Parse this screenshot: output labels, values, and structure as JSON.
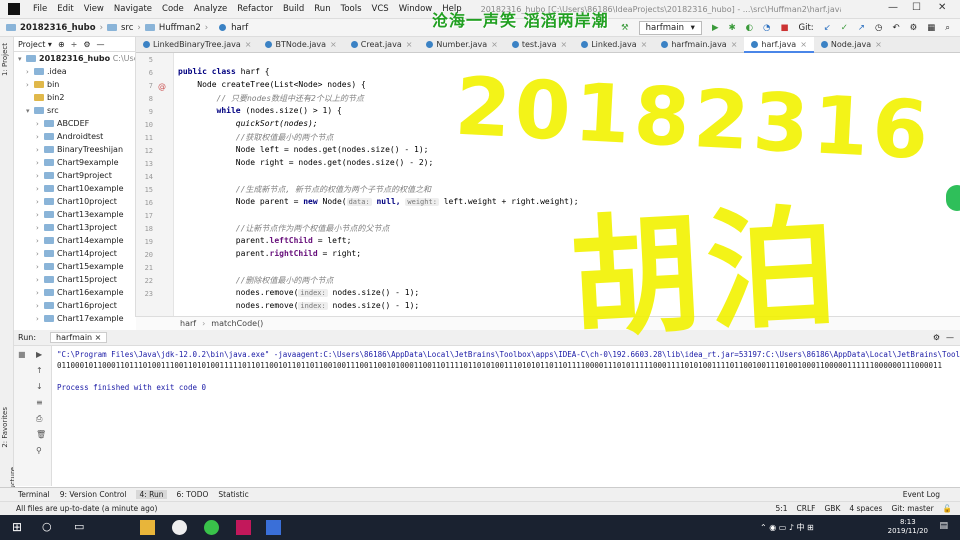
{
  "menubar": {
    "items": [
      "File",
      "Edit",
      "View",
      "Navigate",
      "Code",
      "Analyze",
      "Refactor",
      "Build",
      "Run",
      "Tools",
      "VCS",
      "Window",
      "Help"
    ],
    "window_title": "20182316_hubo [C:\\Users\\86186\\IdeaProjects\\20182316_hubo] - ...\\src\\Huffman2\\harf.java - IntelliJ IDEA"
  },
  "overlay": {
    "banner": "沧海一声笑 滔滔两岸潮",
    "handwriting_id": "20182316",
    "handwriting_name": "胡泊"
  },
  "navbar": {
    "project": "20182316_hubo",
    "src": "src",
    "pkg": "Huffman2",
    "file": "harf",
    "run_config": "harfmain",
    "git_label": "Git:"
  },
  "project": {
    "header": "Project",
    "root_label": "20182316_hubo",
    "root_path": "C:\\Users\\86186\\",
    "items": [
      ".idea",
      "bin",
      "bin2",
      "src",
      "ABCDEF",
      "Androidtest",
      "BinaryTreeshijan",
      "Chart9example",
      "Chart9project",
      "Chart10example",
      "Chart10project",
      "Chart13example",
      "Chart13project",
      "Chart14example",
      "Chart14project",
      "Chart15example",
      "Chart15project",
      "Chart16example",
      "Chart16project",
      "Chart17example"
    ]
  },
  "tabs": [
    "LinkedBinaryTree.java",
    "BTNode.java",
    "Creat.java",
    "Number.java",
    "test.java",
    "Linked.java",
    "harfmain.java",
    "harf.java",
    "Node.java"
  ],
  "editor": {
    "line_numbers": [
      "5",
      "6",
      "7",
      "8",
      "9",
      "10",
      "11",
      "12",
      "13",
      "14",
      "15",
      "16",
      "17",
      "18",
      "19",
      "20",
      "21",
      "22",
      "23"
    ],
    "l6_kw": "public class",
    "l6_rest": "harf {",
    "l7": "    Node createTree(List<Node> nodes) {",
    "l8": "        // 只要nodes数组中还有2个以上的节点",
    "l9_kw": "while",
    "l9_rest": " (nodes.size() > 1) {",
    "l10": "            quickSort(nodes);",
    "l11": "            //获取权值最小的两个节点",
    "l12": "            Node left = nodes.get(nodes.size() - 1);",
    "l13": "            Node right = nodes.get(nodes.size() - 2);",
    "l15": "            //生成新节点, 新节点的权值为两个子节点的权值之和",
    "l16_pre": "            Node parent = ",
    "l16_new": "new",
    "l16_mid": " Node(",
    "l16_hint1": "data:",
    "l16_null": " null,",
    "l16_hint2": "weight:",
    "l16_post": " left.weight + right.weight);",
    "l18": "            //让新节点作为两个权值最小节点的父节点",
    "l19_pre": "            parent.",
    "l19_fld": "leftChild",
    "l19_post": " = left;",
    "l20_pre": "            parent.",
    "l20_fld": "rightChild",
    "l20_post": " = right;",
    "l22": "            //删除权值最小的两个节点",
    "l23_pre": "            nodes.remove(",
    "l23_hint": "index:",
    "l23_post": " nodes.size() - 1);",
    "l24_pre": "            nodes.remove(",
    "l24_hint": "index:",
    "l24_post": " nodes.size() - 1);"
  },
  "breadcrumb": {
    "a": "harf",
    "b": "matchCode()"
  },
  "run": {
    "label": "Run:",
    "config": "harfmain",
    "line1": "\"C:\\Program Files\\Java\\jdk-12.0.2\\bin\\java.exe\" -javaagent:C:\\Users\\86186\\AppData\\Local\\JetBrains\\Toolbox\\apps\\IDEA-C\\ch-0\\192.6603.28\\lib\\idea_rt.jar=53197:C:\\Users\\86186\\AppData\\Local\\JetBrains\\Toolb",
    "line2": "0110001011000110111010011100110101001111101101100101101101100100111001100101000110011011110110101001110101011011011110000111010111110001111010100111101100100111010010001100000111111000000111000011",
    "line3": "Process finished with exit code 0"
  },
  "bottomtabs": [
    "Terminal",
    "9: Version Control",
    "4: Run",
    "6: TODO",
    "Statistic"
  ],
  "event_log": "Event Log",
  "status": {
    "msg": "All files are up-to-date (a minute ago)",
    "pos": "5:1",
    "crlf": "CRLF",
    "enc": "GBK",
    "indent": "4 spaces",
    "git": "Git: master"
  },
  "clock": {
    "time": "8:13",
    "date": "2019/11/20"
  },
  "side": {
    "project_tab": "1: Project",
    "favorites_tab": "2: Favorites",
    "structure_tab": "7: Structure"
  }
}
